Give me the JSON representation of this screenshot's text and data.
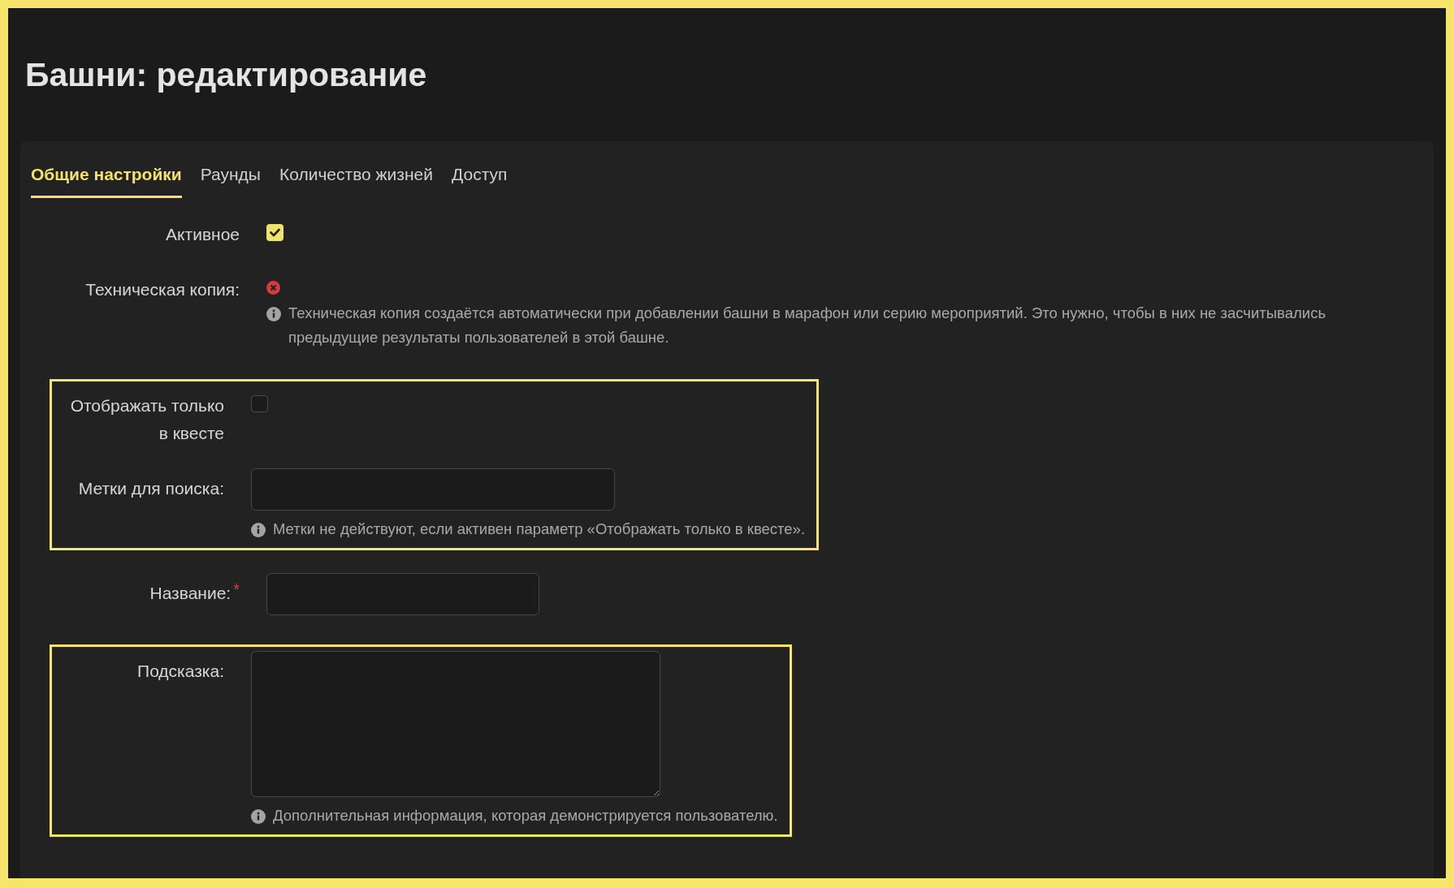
{
  "page": {
    "title": "Башни: редактирование"
  },
  "tabs": [
    {
      "label": "Общие настройки",
      "selected": true
    },
    {
      "label": "Раунды",
      "selected": false
    },
    {
      "label": "Количество жизней",
      "selected": false
    },
    {
      "label": "Доступ",
      "selected": false
    }
  ],
  "groups": [
    {
      "highlighted": false,
      "fields": [
        {
          "kind": "checkbox",
          "label": "Активное",
          "checked": true
        },
        {
          "kind": "status",
          "label": "Техническая копия:",
          "on": false,
          "hint": "Техническая копия создаётся автоматически при добавлении башни в марафон или серию мероприятий. Это нужно, чтобы в них не засчитывались предыдущие результаты пользователей в этой башне."
        }
      ]
    },
    {
      "highlighted": true,
      "fields": [
        {
          "kind": "checkbox",
          "label": "Отображать только в квесте",
          "checked": false
        },
        {
          "kind": "wideinput",
          "label": "Метки для поиска:",
          "hint": "Метки не действуют, если активен параметр «Отображать только в квесте»."
        }
      ]
    },
    {
      "highlighted": false,
      "fields": [
        {
          "kind": "input",
          "label": "Название:",
          "required_mark": "*"
        }
      ]
    },
    {
      "highlighted": true,
      "fields": [
        {
          "kind": "textarea",
          "label": "Подсказка:",
          "hint": "Дополнительная информация, которая демонстрируется пользователю."
        }
      ]
    }
  ]
}
